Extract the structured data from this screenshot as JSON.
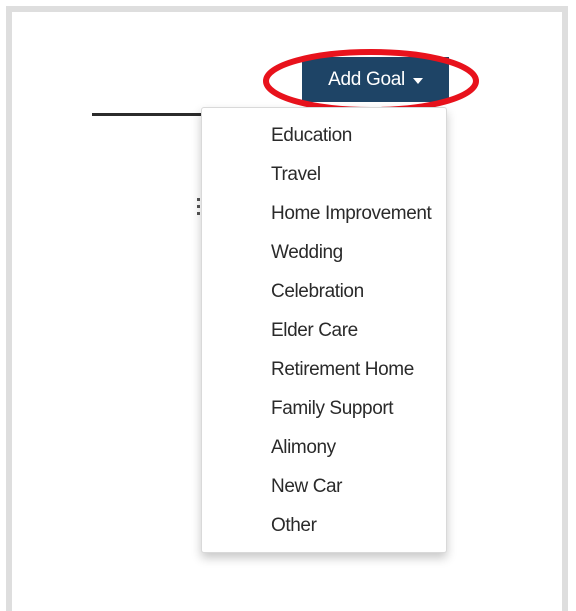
{
  "add_goal_button": {
    "label": "Add Goal",
    "icon": "caret-down-icon"
  },
  "dropdown": {
    "items": [
      {
        "label": "Education"
      },
      {
        "label": "Travel"
      },
      {
        "label": "Home Improvement"
      },
      {
        "label": "Wedding"
      },
      {
        "label": "Celebration"
      },
      {
        "label": "Elder Care"
      },
      {
        "label": "Retirement Home"
      },
      {
        "label": "Family Support"
      },
      {
        "label": "Alimony"
      },
      {
        "label": "New Car"
      },
      {
        "label": "Other"
      }
    ]
  },
  "colors": {
    "button_bg": "#1e4466",
    "button_text": "#ffffff",
    "highlight": "#e8121c",
    "menu_text": "#2a2a2a"
  }
}
